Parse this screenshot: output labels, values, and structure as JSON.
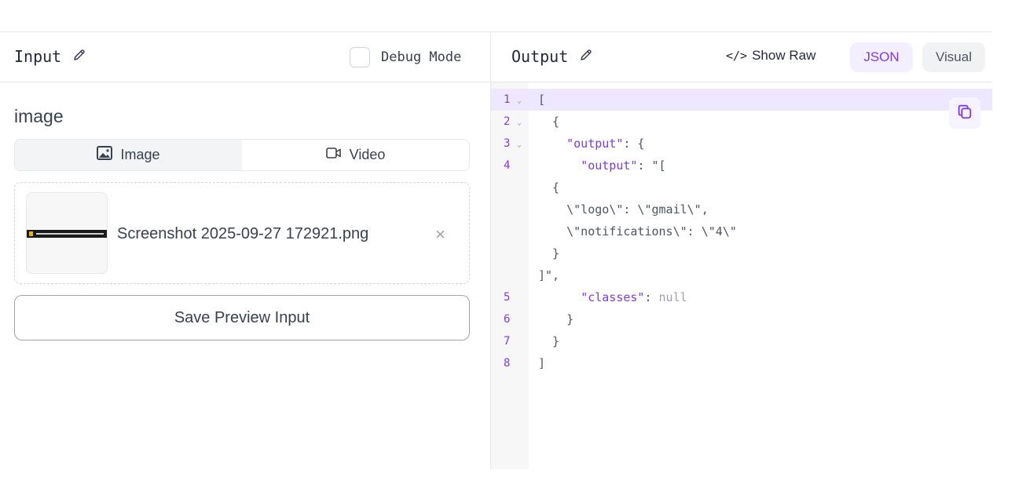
{
  "input_panel": {
    "title": "Input",
    "debug_label": "Debug Mode",
    "field_label": "image",
    "tabs": [
      {
        "label": "Image",
        "active": true
      },
      {
        "label": "Video",
        "active": false
      }
    ],
    "file": {
      "name": "Screenshot 2025-09-27 172921.png"
    },
    "remove_symbol": "×",
    "save_label": "Save Preview Input"
  },
  "output_panel": {
    "title": "Output",
    "show_raw_label": "Show Raw",
    "show_raw_glyph": "</>",
    "view_modes": [
      {
        "label": "JSON",
        "active": true
      },
      {
        "label": "Visual",
        "active": false
      }
    ]
  },
  "code_lines": [
    {
      "ln": "1",
      "fold": "⌄",
      "segments": [
        {
          "t": "["
        }
      ]
    },
    {
      "ln": "2",
      "fold": "⌄",
      "segments": [
        {
          "t": "  {"
        }
      ]
    },
    {
      "ln": "3",
      "fold": "⌄",
      "segments": [
        {
          "t": "    "
        },
        {
          "t": "\"output\"",
          "c": "key"
        },
        {
          "t": ": {"
        }
      ]
    },
    {
      "ln": "4",
      "fold": "",
      "segments": [
        {
          "t": "      "
        },
        {
          "t": "\"output\"",
          "c": "key"
        },
        {
          "t": ": \"["
        }
      ]
    },
    {
      "ln": "",
      "fold": "",
      "segments": [
        {
          "t": "  {"
        }
      ]
    },
    {
      "ln": "",
      "fold": "",
      "segments": [
        {
          "t": "    \\\"logo\\\": \\\"gmail\\\","
        }
      ]
    },
    {
      "ln": "",
      "fold": "",
      "segments": [
        {
          "t": "    \\\"notifications\\\": \\\"4\\\""
        }
      ]
    },
    {
      "ln": "",
      "fold": "",
      "segments": [
        {
          "t": "  }"
        }
      ]
    },
    {
      "ln": "",
      "fold": "",
      "segments": [
        {
          "t": "]\","
        }
      ]
    },
    {
      "ln": "5",
      "fold": "",
      "segments": [
        {
          "t": "      "
        },
        {
          "t": "\"classes\"",
          "c": "key"
        },
        {
          "t": ": "
        },
        {
          "t": "null",
          "c": "null"
        }
      ]
    },
    {
      "ln": "6",
      "fold": "",
      "segments": [
        {
          "t": "    }"
        }
      ]
    },
    {
      "ln": "7",
      "fold": "",
      "segments": [
        {
          "t": "  }"
        }
      ]
    },
    {
      "ln": "8",
      "fold": "",
      "segments": [
        {
          "t": "]"
        }
      ]
    }
  ],
  "icons": {
    "edit": "pencil-icon",
    "image_tab": "image-icon",
    "video_tab": "video-icon",
    "copy": "copy-icon"
  },
  "colors": {
    "accent": "#7c3aed",
    "accent_bg": "#f3efff",
    "highlight_line": "#eee7ff",
    "border": "#e5e7eb"
  }
}
